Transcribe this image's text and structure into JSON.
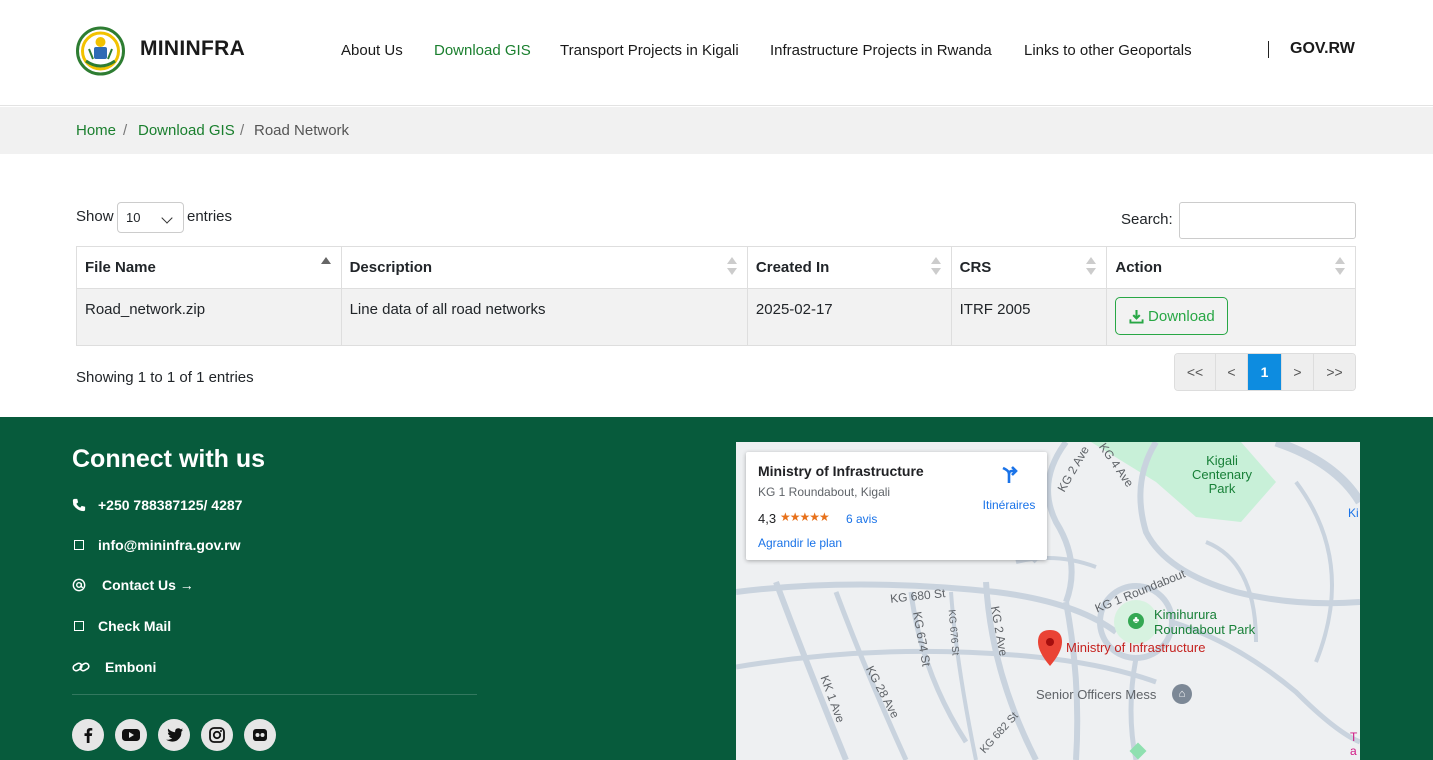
{
  "header": {
    "brand": "MININFRA",
    "nav": [
      {
        "label": "About Us",
        "active": false
      },
      {
        "label": "Download GIS",
        "active": true
      },
      {
        "label": "Transport Projects in Kigali",
        "active": false
      },
      {
        "label": "Infrastructure Projects in Rwanda",
        "active": false
      },
      {
        "label": "Links to other Geoportals",
        "active": false
      }
    ],
    "gov_link": "GOV.RW"
  },
  "breadcrumb": {
    "home": "Home",
    "section": "Download GIS",
    "current": "Road Network",
    "separator": "/"
  },
  "table_controls": {
    "show_label": "Show",
    "entries_value": "10",
    "entries_label": "entries",
    "search_label": "Search:",
    "search_value": ""
  },
  "table": {
    "columns": [
      "File Name",
      "Description",
      "Created In",
      "CRS",
      "Action"
    ],
    "rows": [
      {
        "file_name": "Road_network.zip",
        "description": "Line data of all road networks",
        "created_in": "2025-02-17",
        "crs": "ITRF 2005",
        "action_label": "Download"
      }
    ]
  },
  "footer_info": {
    "showing": "Showing 1 to 1 of 1 entries",
    "pagination": {
      "first": "<<",
      "prev": "<",
      "current": "1",
      "next": ">",
      "last": ">>"
    }
  },
  "footer": {
    "heading": "Connect with us",
    "phone": "+250 788387125/ 4287",
    "email": "info@mininfra.gov.rw",
    "contact_us": "Contact Us →",
    "check_mail": "Check Mail",
    "emboni": "Emboni",
    "socials": [
      "facebook-icon",
      "youtube-icon",
      "twitter-icon",
      "instagram-icon",
      "flickr-icon"
    ]
  },
  "map": {
    "card": {
      "title": "Ministry of Infrastructure",
      "address": "KG 1 Roundabout, Kigali",
      "rating": "4,3",
      "stars": "★★★★★",
      "reviews": "6 avis",
      "enlarge": "Agrandir le plan",
      "directions": "Itinéraires"
    },
    "labels": {
      "kg2ave_top": "KG 2 Ave",
      "kg4ave": "KG 4 Ave",
      "park": "Kigali Centenary Park",
      "park_line1": "Kigali",
      "park_line2": "Centenary",
      "park_line3": "Park",
      "ki": "Ki",
      "kg1_roundabout": "KG 1 Roundabout",
      "kg680": "KG 680 St",
      "kg674": "KG 674 St",
      "kg676": "KG 676 St",
      "kg2ave": "KG 2 Ave",
      "kimihurura": "Kimihurura",
      "roundabout_park": "Roundabout Park",
      "ministry": "Ministry of Infrastructure",
      "senior": "Senior Officers Mess",
      "kk1ave": "KK 1 Ave",
      "kg28ave": "KG 28 Ave",
      "kg682": "KG 682 St",
      "t": "T",
      "a": "a"
    },
    "colors": {
      "pin": "#ea4335",
      "park": "#c8f0d8",
      "park_text": "#188038",
      "road": "#c9d3de"
    }
  },
  "colors": {
    "accent_green": "#1a7f2e",
    "footer_bg": "#075b3c",
    "pager_active": "#0d8ce0"
  }
}
